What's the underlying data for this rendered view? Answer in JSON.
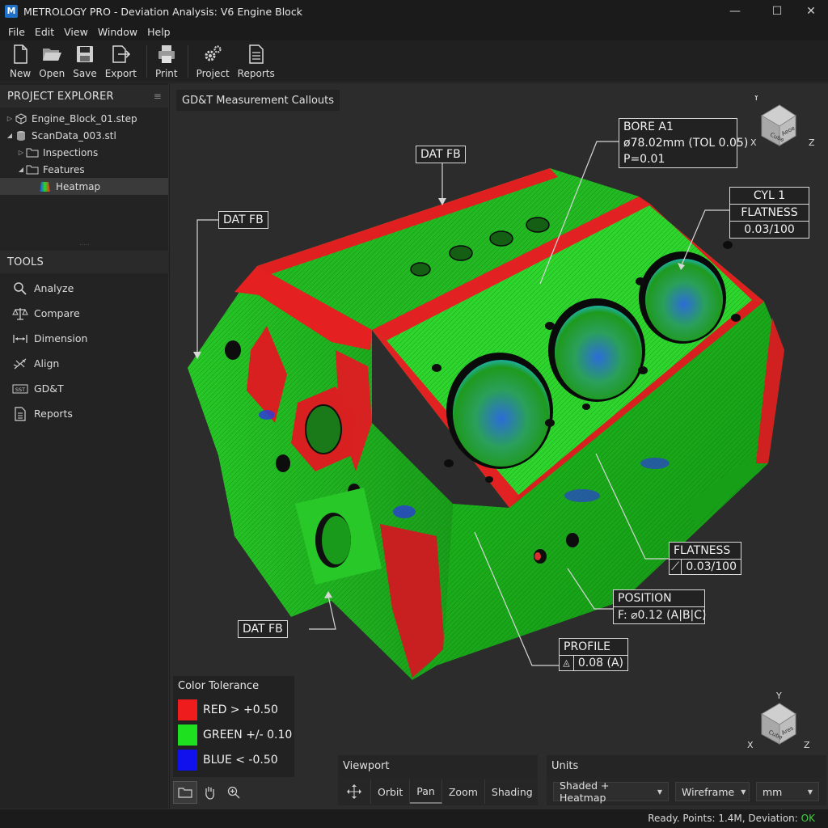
{
  "window": {
    "logo": "M",
    "title": "METROLOGY PRO - Deviation Analysis: V6 Engine Block",
    "controls": {
      "minimize": "—",
      "maximize": "☐",
      "close": "✕"
    }
  },
  "menu": [
    "File",
    "Edit",
    "View",
    "Window",
    "Help"
  ],
  "toolbar": {
    "new": "New",
    "open": "Open",
    "save": "Save",
    "export": "Export",
    "print": "Print",
    "project": "Project",
    "reports": "Reports"
  },
  "project_explorer": {
    "title": "PROJECT EXPLORER",
    "items": [
      {
        "label": "Engine_Block_01.step"
      },
      {
        "label": "ScanData_003.stl"
      },
      {
        "label": "Inspections"
      },
      {
        "label": "Features"
      },
      {
        "label": "Heatmap"
      }
    ]
  },
  "tools": {
    "title": "TOOLS",
    "items": [
      {
        "label": "Analyze",
        "icon": "search-icon"
      },
      {
        "label": "Compare",
        "icon": "balance-icon"
      },
      {
        "label": "Dimension",
        "icon": "dimension-icon"
      },
      {
        "label": "Align",
        "icon": "align-icon"
      },
      {
        "label": "GD&T",
        "icon": "gdt-icon"
      },
      {
        "label": "Reports",
        "icon": "report-icon"
      }
    ]
  },
  "viewport": {
    "title": "GD&T Measurement Callouts",
    "callouts": {
      "dat_fb_top": "DAT FB",
      "dat_fb_left": "DAT FB",
      "dat_fb_bottom": "DAT FB",
      "bore": [
        "BORE A1",
        "ø78.02mm (TOL 0.05)",
        "P=0.01"
      ],
      "cyl": [
        "CYL 1",
        "FLATNESS",
        "0.03/100"
      ],
      "flatness": [
        "FLATNESS",
        "0.03/100"
      ],
      "position": [
        "POSITION",
        "F: ⌀0.12 (A|B|C)"
      ],
      "profile": [
        "PROFILE",
        "0.08 (A)"
      ]
    },
    "view_cube": {
      "y": "Y",
      "x": "X",
      "z": "Z",
      "face1": "Cube",
      "face2": "Aeoe",
      "face3": "Ares"
    }
  },
  "legend": {
    "title": "Color Tolerance",
    "rows": [
      {
        "label": "RED  > +0.50",
        "color": "#ee1c1c"
      },
      {
        "label": "GREEN +/- 0.10",
        "color": "#1fe01f"
      },
      {
        "label": "BLUE  < -0.50",
        "color": "#1111ee"
      }
    ]
  },
  "viewport_controls": {
    "title": "Viewport",
    "buttons": [
      "Orbit",
      "Pan",
      "Zoom",
      "Shading"
    ]
  },
  "units": {
    "title": "Units",
    "shading_mode": "Shaded + Heatmap",
    "wireframe": "Wireframe",
    "unit": "mm"
  },
  "status": {
    "text": "Ready. Points: 1.4M, Deviation:",
    "ok": "OK"
  }
}
